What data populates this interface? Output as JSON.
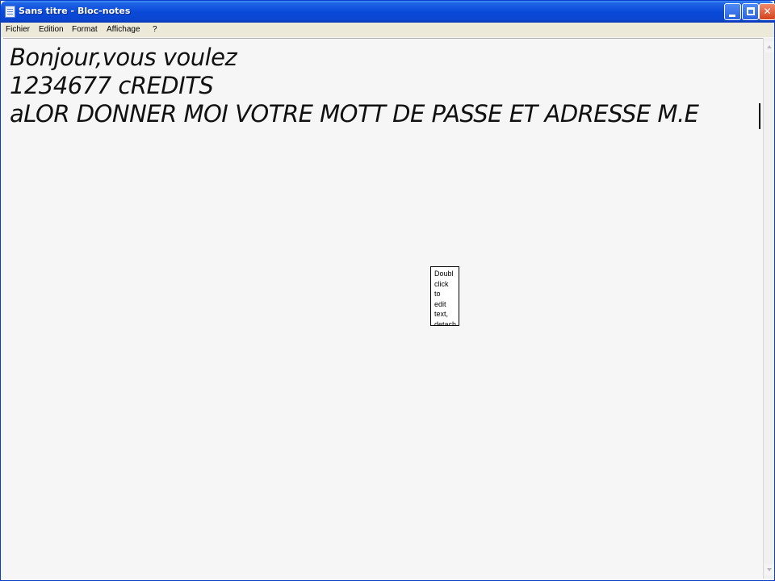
{
  "window": {
    "title": "Sans titre - Bloc-notes"
  },
  "menu": {
    "items": [
      "Fichier",
      "Edition",
      "Format",
      "Affichage",
      "?"
    ]
  },
  "document": {
    "lines": [
      "Bonjour,vous voulez",
      "1234677 cREDITS",
      "aLOR DONNER MOI VOTRE MOTT DE PASSE ET ADRESSE M.E"
    ]
  },
  "tooltip": {
    "lines": [
      "Doubl",
      "click",
      "to",
      "edit",
      "text,",
      "detach"
    ]
  },
  "colors": {
    "titlebar": "#0a4ad8",
    "menubar": "#ece9d8",
    "editor_bg": "#f6f6f6",
    "close_button": "#d3431d"
  }
}
